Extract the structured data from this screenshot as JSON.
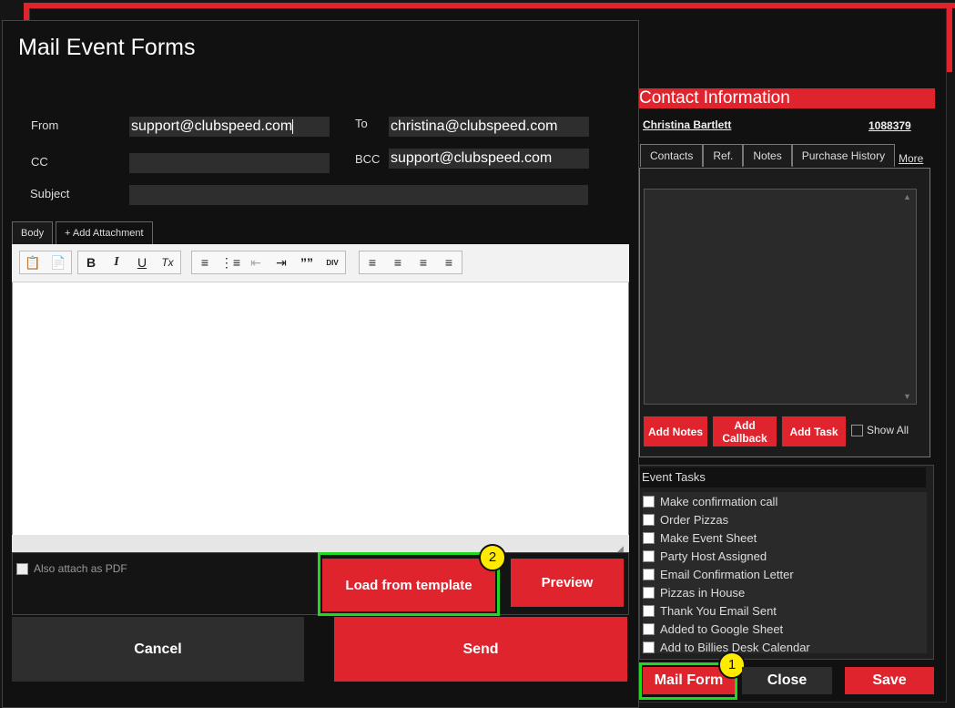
{
  "dialog": {
    "title": "Mail Event Forms",
    "from_label": "From",
    "from_value": "support@clubspeed.com",
    "to_label": "To",
    "to_value": "christina@clubspeed.com",
    "cc_label": "CC",
    "cc_value": "",
    "bcc_label": "BCC",
    "bcc_value": "support@clubspeed.com",
    "subject_label": "Subject",
    "subject_value": "",
    "tabs": [
      "Body",
      "+ Add Attachment"
    ],
    "attach_pdf_label": "Also attach as PDF",
    "load_template_label": "Load from template",
    "preview_label": "Preview",
    "cancel_label": "Cancel",
    "send_label": "Send"
  },
  "toolbar": {
    "bold": "B",
    "italic": "I",
    "underline": "U",
    "remove_format": "Tx",
    "blockquote": "””",
    "div": "DIV"
  },
  "contact": {
    "header": "Contact Information",
    "name": "Christina Bartlett",
    "id": "1088379",
    "tabs": [
      "Contacts",
      "Ref.",
      "Notes",
      "Purchase History"
    ],
    "more": "More",
    "add_notes": "Add Notes",
    "add_callback": "Add Callback",
    "add_task": "Add Task",
    "show_all": "Show All"
  },
  "tasks": {
    "title": "Event Tasks",
    "items": [
      "Make confirmation call",
      "Order Pizzas",
      "Make Event Sheet",
      "Party Host Assigned",
      "Email Confirmation Letter",
      "Pizzas in House",
      "Thank You Email Sent",
      "Added to Google Sheet",
      "Add to Billies Desk Calendar"
    ]
  },
  "footer": {
    "mail_form": "Mail Form",
    "close": "Close",
    "save": "Save"
  },
  "badges": [
    "1",
    "2"
  ],
  "colors": {
    "accent": "#e0242e",
    "highlight": "#22d622",
    "badge": "#ffeb00"
  }
}
